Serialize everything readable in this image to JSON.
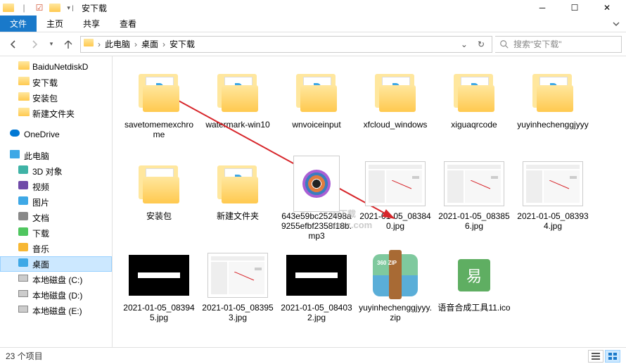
{
  "window": {
    "title": "安下载"
  },
  "ribbon": {
    "file": "文件",
    "tabs": [
      "主页",
      "共享",
      "查看"
    ]
  },
  "breadcrumb": [
    "此电脑",
    "桌面",
    "安下载"
  ],
  "search": {
    "placeholder": "搜索\"安下载\""
  },
  "tree": {
    "items": [
      {
        "label": "BaiduNetdiskD",
        "icon": "folder",
        "indent": 1
      },
      {
        "label": "安下载",
        "icon": "folder",
        "indent": 1
      },
      {
        "label": "安装包",
        "icon": "folder",
        "indent": 1
      },
      {
        "label": "新建文件夹",
        "icon": "folder",
        "indent": 1
      },
      {
        "label": "OneDrive",
        "icon": "onedrive",
        "indent": 0,
        "spaced": true
      },
      {
        "label": "此电脑",
        "icon": "pc",
        "indent": 0,
        "spaced": true
      },
      {
        "label": "3D 对象",
        "icon": "3d",
        "indent": 1
      },
      {
        "label": "视频",
        "icon": "video",
        "indent": 1
      },
      {
        "label": "图片",
        "icon": "pictures",
        "indent": 1
      },
      {
        "label": "文档",
        "icon": "documents",
        "indent": 1
      },
      {
        "label": "下载",
        "icon": "downloads",
        "indent": 1
      },
      {
        "label": "音乐",
        "icon": "music",
        "indent": 1
      },
      {
        "label": "桌面",
        "icon": "desktop",
        "indent": 1,
        "selected": true
      },
      {
        "label": "本地磁盘 (C:)",
        "icon": "disk",
        "indent": 1
      },
      {
        "label": "本地磁盘 (D:)",
        "icon": "disk",
        "indent": 1
      },
      {
        "label": "本地磁盘 (E:)",
        "icon": "disk",
        "indent": 1
      }
    ]
  },
  "items": [
    {
      "name": "savetomemexchrome",
      "type": "app-folder"
    },
    {
      "name": "watermark-win10",
      "type": "app-folder"
    },
    {
      "name": "wnvoiceinput",
      "type": "app-folder"
    },
    {
      "name": "xfcloud_windows",
      "type": "app-folder"
    },
    {
      "name": "xiguaqrcode",
      "type": "app-folder"
    },
    {
      "name": "yuyinhechenggjyyy",
      "type": "app-folder"
    },
    {
      "name": "安装包",
      "type": "folder"
    },
    {
      "name": "新建文件夹",
      "type": "app-folder"
    },
    {
      "name": "643e59bc252498a9255efbf2358f18b.mp3",
      "type": "mp3"
    },
    {
      "name": "2021-01-05_083840.jpg",
      "type": "screenshot"
    },
    {
      "name": "2021-01-05_083856.jpg",
      "type": "screenshot"
    },
    {
      "name": "2021-01-05_083934.jpg",
      "type": "screenshot"
    },
    {
      "name": "2021-01-05_083945.jpg",
      "type": "black"
    },
    {
      "name": "2021-01-05_083953.jpg",
      "type": "screenshot"
    },
    {
      "name": "2021-01-05_084032.jpg",
      "type": "black"
    },
    {
      "name": "yuyinhechenggjyyy.zip",
      "type": "zip",
      "ziptxt": "360\nZIP"
    },
    {
      "name": "语音合成工具11.ico",
      "type": "ico",
      "icotxt": "易"
    }
  ],
  "status": {
    "count": "23 个项目"
  },
  "watermark": {
    "main": "安下载",
    "sub": "anxz.com"
  }
}
